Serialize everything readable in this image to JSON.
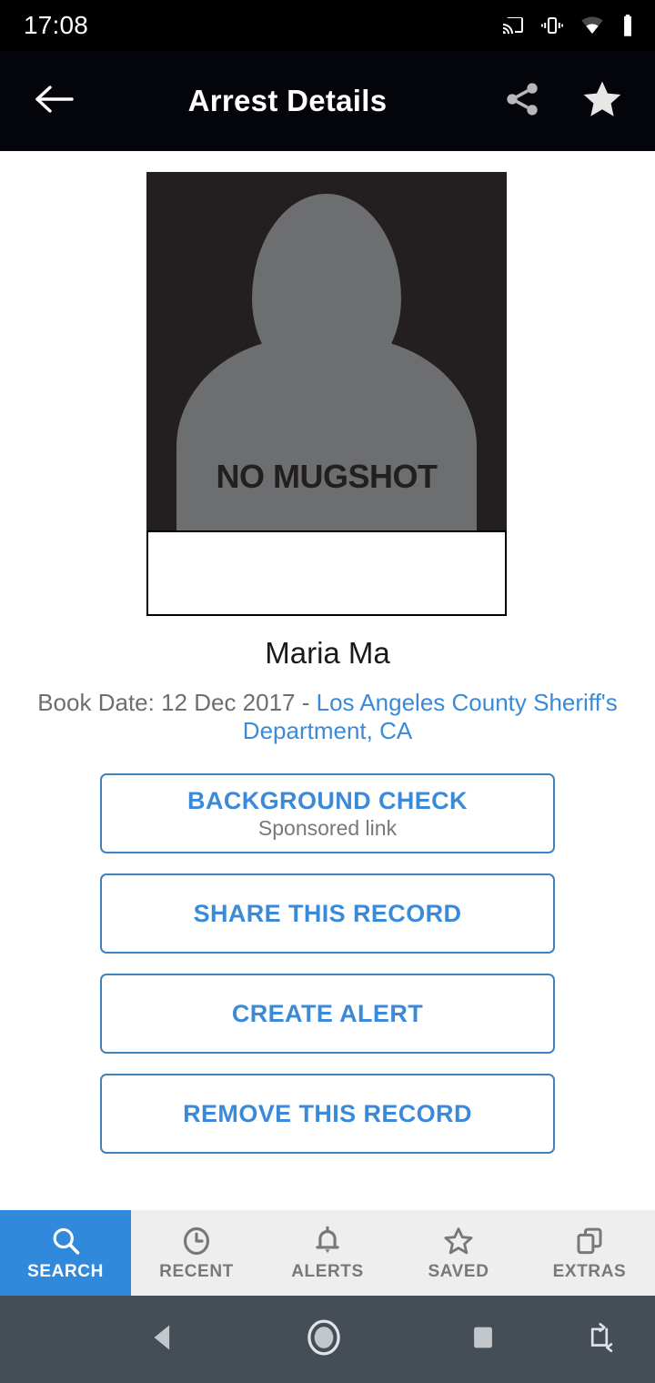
{
  "status_bar": {
    "time": "17:08",
    "icons": [
      "cast-icon",
      "vibrate-icon",
      "wifi-icon",
      "battery-icon"
    ]
  },
  "app_bar": {
    "back_icon": "arrow-left-icon",
    "title": "Arrest Details",
    "share_icon": "share-icon",
    "favorite_icon": "star-filled-icon"
  },
  "record": {
    "mugshot_placeholder_text": "NO MUGSHOT",
    "name": "Maria Ma",
    "book_date_label": "Book Date: 12 Dec 2017 - ",
    "agency": "Los Angeles County Sheriff's Department, CA"
  },
  "actions": [
    {
      "label": "BACKGROUND CHECK",
      "sub": "Sponsored link",
      "name": "background-check-button"
    },
    {
      "label": "SHARE THIS RECORD",
      "sub": "",
      "name": "share-record-button"
    },
    {
      "label": "CREATE ALERT",
      "sub": "",
      "name": "create-alert-button"
    },
    {
      "label": "REMOVE THIS RECORD",
      "sub": "",
      "name": "remove-record-button"
    }
  ],
  "bottom_nav": [
    {
      "label": "SEARCH",
      "icon": "search-icon",
      "active": true
    },
    {
      "label": "RECENT",
      "icon": "clock-icon",
      "active": false
    },
    {
      "label": "ALERTS",
      "icon": "bell-icon",
      "active": false
    },
    {
      "label": "SAVED",
      "icon": "star-outline-icon",
      "active": false
    },
    {
      "label": "EXTRAS",
      "icon": "windows-icon",
      "active": false
    }
  ],
  "system_nav": {
    "back_icon": "triangle-back-icon",
    "home_icon": "circle-home-icon",
    "recents_icon": "square-recents-icon",
    "rotate_icon": "rotate-screen-icon"
  },
  "colors": {
    "accent_blue": "#3b8ad8",
    "nav_active_blue": "#3089db",
    "border_blue": "#3f81bd",
    "muted_gray": "#77787b",
    "status_bar_bg": "#000000",
    "app_bar_bg": "#04050a",
    "bottom_nav_bg": "#eeeeee",
    "system_nav_bg": "#454d56"
  }
}
